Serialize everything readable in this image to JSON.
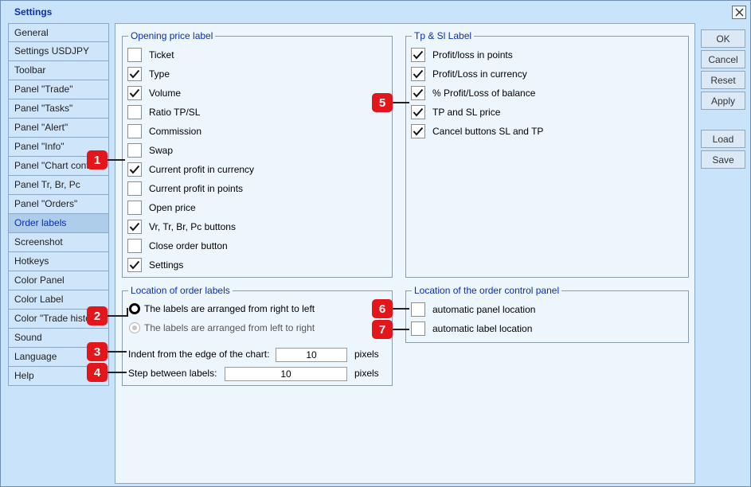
{
  "window": {
    "title": "Settings"
  },
  "sidebar": {
    "items": [
      {
        "label": "General",
        "active": false
      },
      {
        "label": "Settings USDJPY",
        "active": false
      },
      {
        "label": "Toolbar",
        "active": false
      },
      {
        "label": "Panel \"Trade\"",
        "active": false
      },
      {
        "label": "Panel \"Tasks\"",
        "active": false
      },
      {
        "label": "Panel \"Alert\"",
        "active": false
      },
      {
        "label": "Panel \"Info\"",
        "active": false
      },
      {
        "label": "Panel \"Chart control\"",
        "active": false
      },
      {
        "label": "Panel Tr, Br, Pc",
        "active": false
      },
      {
        "label": "Panel \"Orders\"",
        "active": false
      },
      {
        "label": "Order labels",
        "active": true
      },
      {
        "label": "Screenshot",
        "active": false
      },
      {
        "label": "Hotkeys",
        "active": false
      },
      {
        "label": "Color Panel",
        "active": false
      },
      {
        "label": "Color Label",
        "active": false
      },
      {
        "label": "Color \"Trade history\"",
        "active": false
      },
      {
        "label": "Sound",
        "active": false
      },
      {
        "label": "Language",
        "active": false
      },
      {
        "label": "Help",
        "active": false
      }
    ]
  },
  "opening_price_label": {
    "title": "Opening price label",
    "items": [
      {
        "label": "Ticket",
        "checked": false
      },
      {
        "label": "Type",
        "checked": true
      },
      {
        "label": "Volume",
        "checked": true
      },
      {
        "label": "Ratio TP/SL",
        "checked": false
      },
      {
        "label": "Commission",
        "checked": false
      },
      {
        "label": "Swap",
        "checked": false
      },
      {
        "label": "Current profit in currency",
        "checked": true
      },
      {
        "label": "Current profit in points",
        "checked": false
      },
      {
        "label": "Open price",
        "checked": false
      },
      {
        "label": "Vr, Tr, Br, Pc buttons",
        "checked": true
      },
      {
        "label": "Close order button",
        "checked": false
      },
      {
        "label": "Settings",
        "checked": true
      }
    ]
  },
  "tp_sl_label": {
    "title": "Tp & Sl Label",
    "items": [
      {
        "label": "Profit/loss in points",
        "checked": true
      },
      {
        "label": "Profit/Loss in currency",
        "checked": true
      },
      {
        "label": "% Profit/Loss of balance",
        "checked": true
      },
      {
        "label": "TP and SL price",
        "checked": true
      },
      {
        "label": "Cancel buttons SL and TP",
        "checked": true
      }
    ]
  },
  "location_labels": {
    "title": "Location of order labels",
    "radio_right_to_left": "The labels are arranged from right to left",
    "radio_left_to_right": "The labels are arranged from left to right",
    "selected": "right_to_left",
    "indent_label": "Indent from the edge of the chart:",
    "indent_value": "10",
    "indent_unit": "pixels",
    "step_label": "Step between labels:",
    "step_value": "10",
    "step_unit": "pixels"
  },
  "location_panel": {
    "title": "Location of the order control panel",
    "items": [
      {
        "label": "automatic panel location",
        "checked": false
      },
      {
        "label": "automatic label location",
        "checked": false
      }
    ]
  },
  "buttons": {
    "ok": "OK",
    "cancel": "Cancel",
    "reset": "Reset",
    "apply": "Apply",
    "load": "Load",
    "save": "Save"
  },
  "badges": [
    "1",
    "2",
    "3",
    "4",
    "5",
    "6",
    "7"
  ],
  "icons": {
    "close": "close-icon",
    "check": "checkmark-icon"
  },
  "colors": {
    "accent_text": "#0b2fae",
    "badge": "#e3161b",
    "window_bg": "#c9e3fb",
    "panel_bg": "#eef6fd"
  }
}
